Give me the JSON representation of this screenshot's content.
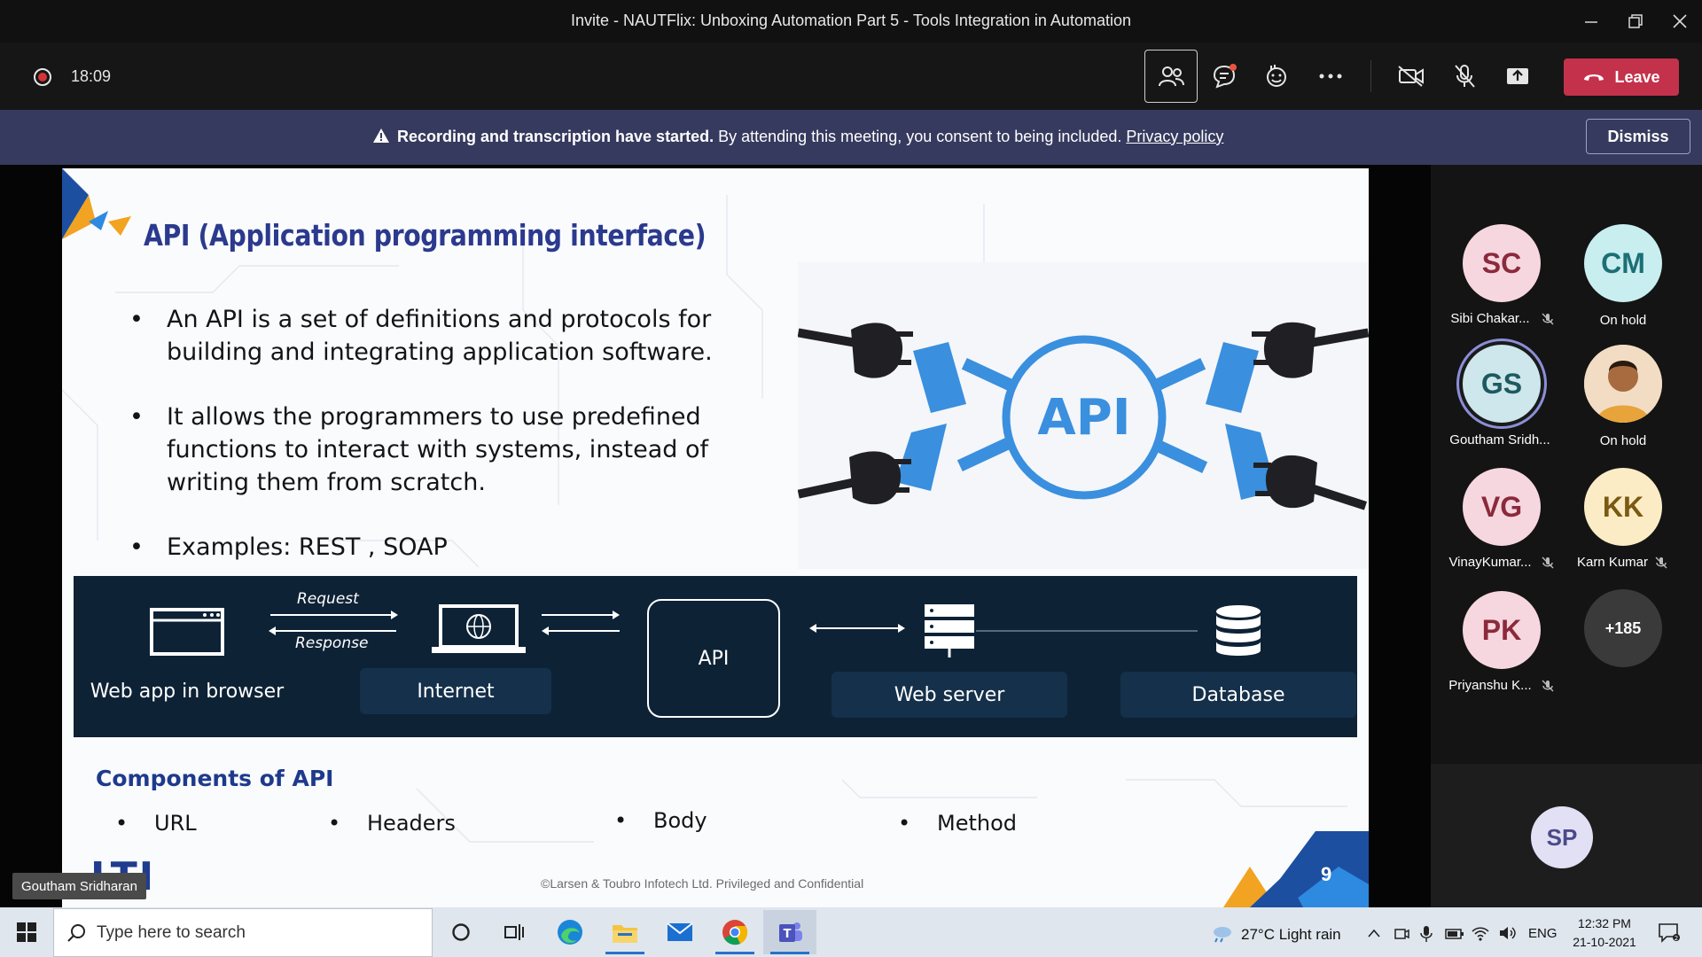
{
  "window": {
    "title": "Invite - NAUTFlix: Unboxing Automation Part 5 - Tools Integration in Automation"
  },
  "meeting": {
    "timer": "18:09",
    "leave_label": "Leave"
  },
  "banner": {
    "bold_text": "Recording and transcription have started.",
    "text": " By attending this meeting, you consent to being included. ",
    "link": "Privacy policy",
    "dismiss": "Dismiss"
  },
  "slide": {
    "title": "API (Application programming interface)",
    "bullets": [
      "An API is a set of definitions and protocols for building and integrating application software.",
      "It allows the programmers to use predefined functions to interact with systems, instead of writing them from scratch.",
      "Examples: REST , SOAP"
    ],
    "graphic_label": "API",
    "flow": {
      "web_app": "Web app in browser",
      "request": "Request",
      "response": "Response",
      "internet": "Internet",
      "api": "API",
      "web_server": "Web server",
      "database": "Database"
    },
    "components_title": "Components of API",
    "components": [
      "URL",
      "Headers",
      "Body",
      "Method"
    ],
    "footer": "©Larsen & Toubro Infotech Ltd. Privileged and Confidential",
    "logo_text": "LTI",
    "page_number": "9"
  },
  "presenter_tag": "Goutham Sridharan",
  "participants": [
    {
      "initials": "SC",
      "name": "Sibi Chakar...",
      "muted": true,
      "bg": "#f7d7df",
      "fg": "#8b2a3c"
    },
    {
      "initials": "CM",
      "name": "On hold",
      "muted": false,
      "bg": "#c9eef0",
      "fg": "#1b6f75"
    },
    {
      "initials": "GS",
      "name": "Goutham Sridh...",
      "muted": false,
      "bg": "#cde7ec",
      "fg": "#1f5960"
    },
    {
      "initials": "",
      "name": "On hold",
      "muted": false,
      "bg": "#e7c9a8",
      "fg": "#333333"
    },
    {
      "initials": "VG",
      "name": "VinayKumar...",
      "muted": true,
      "bg": "#f7d7df",
      "fg": "#8b2a3c"
    },
    {
      "initials": "KK",
      "name": "Karn Kumar",
      "muted": true,
      "bg": "#fbecc5",
      "fg": "#7a5a12"
    },
    {
      "initials": "PK",
      "name": "Priyanshu K...",
      "muted": true,
      "bg": "#f7d7df",
      "fg": "#8b2a3c"
    },
    {
      "initials": "+185",
      "name": "",
      "muted": false,
      "bg": "#3a3a3a",
      "fg": "#ffffff"
    }
  ],
  "self_avatar": "SP",
  "taskbar": {
    "search_placeholder": "Type here to search",
    "weather": "27°C  Light rain",
    "language": "ENG",
    "time": "12:32 PM",
    "date": "21-10-2021"
  }
}
